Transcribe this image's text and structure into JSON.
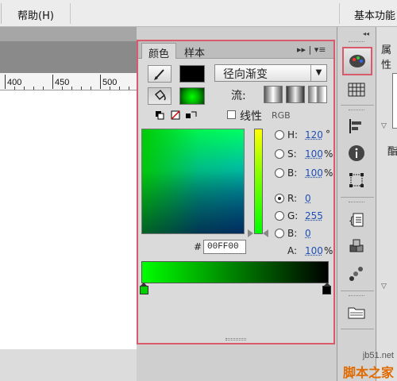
{
  "menubar": {
    "help": "帮助(H)",
    "workspace": "基本功能"
  },
  "ruler": {
    "ticks": [
      "400",
      "450",
      "500"
    ]
  },
  "color_panel": {
    "tabs": {
      "color": "颜色",
      "swatches": "样本"
    },
    "controls": "▸▸ | ▾≡",
    "type": "径向渐变",
    "flow_label": "流:",
    "linear_label": "线性",
    "rgb_label": "RGB",
    "hsb": {
      "h": {
        "label": "H:",
        "value": "120",
        "unit": "°"
      },
      "s": {
        "label": "S:",
        "value": "100",
        "unit": "%"
      },
      "b": {
        "label": "B:",
        "value": "100",
        "unit": "%"
      }
    },
    "rgb": {
      "r": {
        "label": "R:",
        "value": "0"
      },
      "g": {
        "label": "G:",
        "value": "255"
      },
      "b": {
        "label": "B:",
        "value": "0"
      }
    },
    "alpha": {
      "label": "A:",
      "value": "100",
      "unit": "%"
    },
    "hex_label": "#",
    "hex": "00FF00",
    "colors": {
      "stroke": "#000000",
      "fill_center": "#00ff00",
      "gradient_start": "#00ff00",
      "gradient_end": "#000000",
      "highlight": "#d95a6a"
    }
  },
  "properties": {
    "title": "属性",
    "char": "酯"
  },
  "watermark": {
    "site": "jb51.net",
    "text": "脚本之家"
  }
}
